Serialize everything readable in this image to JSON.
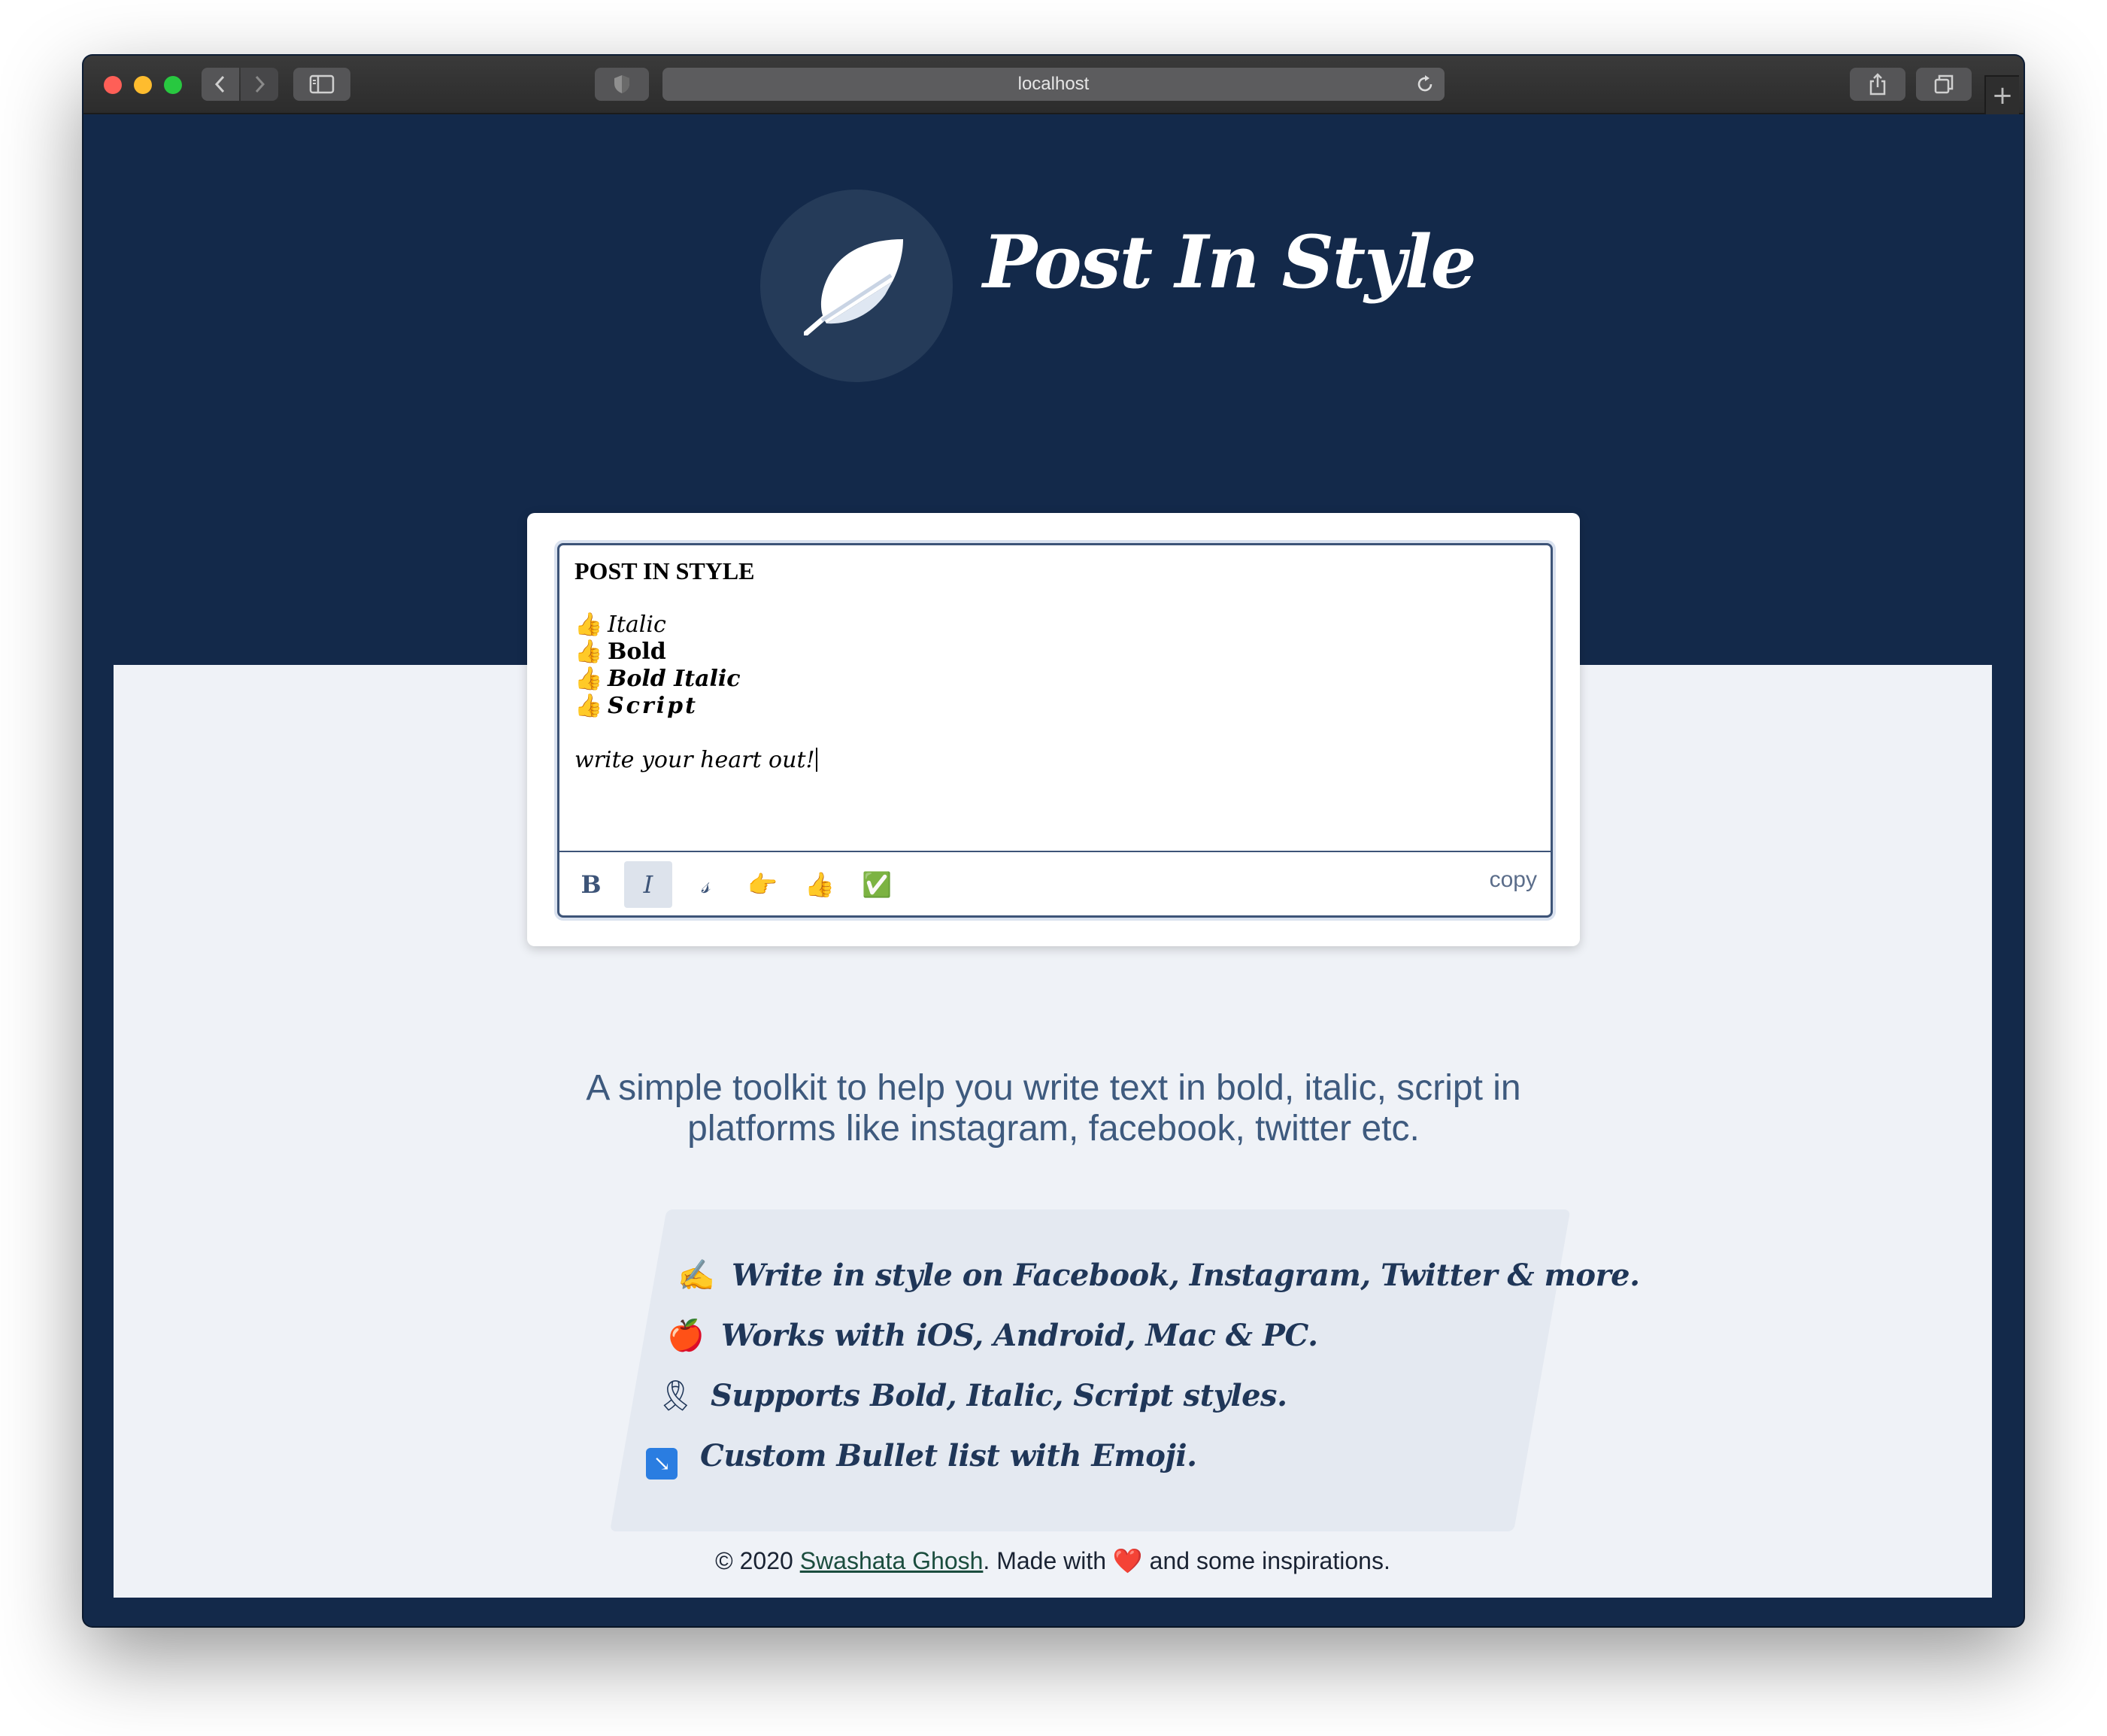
{
  "browser": {
    "url": "localhost",
    "new_tab": "+"
  },
  "header": {
    "title": "Post In Style"
  },
  "editor": {
    "heading": "POST IN STYLE",
    "bullet_emoji": "👍",
    "items": [
      {
        "label": "Italic"
      },
      {
        "label": "Bold"
      },
      {
        "label": "Bold Italic"
      },
      {
        "label": "Script"
      }
    ],
    "closing": "write your heart out!"
  },
  "toolbar": {
    "bold": "B",
    "italic": "I",
    "script": "𝓈",
    "point_emoji": "👉",
    "thumbs_emoji": "👍",
    "check_emoji": "✅",
    "copy": "copy",
    "active": "italic"
  },
  "tagline": "A simple toolkit to help you write text in bold, italic, script in platforms like instagram, facebook, twitter etc.",
  "features": [
    {
      "icon": "✍",
      "text": "Write in style on Facebook, Instagram, Twitter & more."
    },
    {
      "icon": "🍎",
      "text": "Works with iOS, Android, Mac & PC."
    },
    {
      "icon": "🎗",
      "text": "Supports Bold, Italic, Script styles."
    },
    {
      "icon": "↘",
      "text": "Custom Bullet list with Emoji."
    }
  ],
  "footer": {
    "prefix": "© 2020 ",
    "author": "Swashata Ghosh",
    "middle": ". Made with ",
    "heart": "❤️",
    "suffix": " and some inspirations."
  },
  "colors": {
    "navy": "#13294a",
    "light_bg": "#eff2f7",
    "accent_text": "#3e5a7e",
    "feature_text": "#1f3658"
  }
}
